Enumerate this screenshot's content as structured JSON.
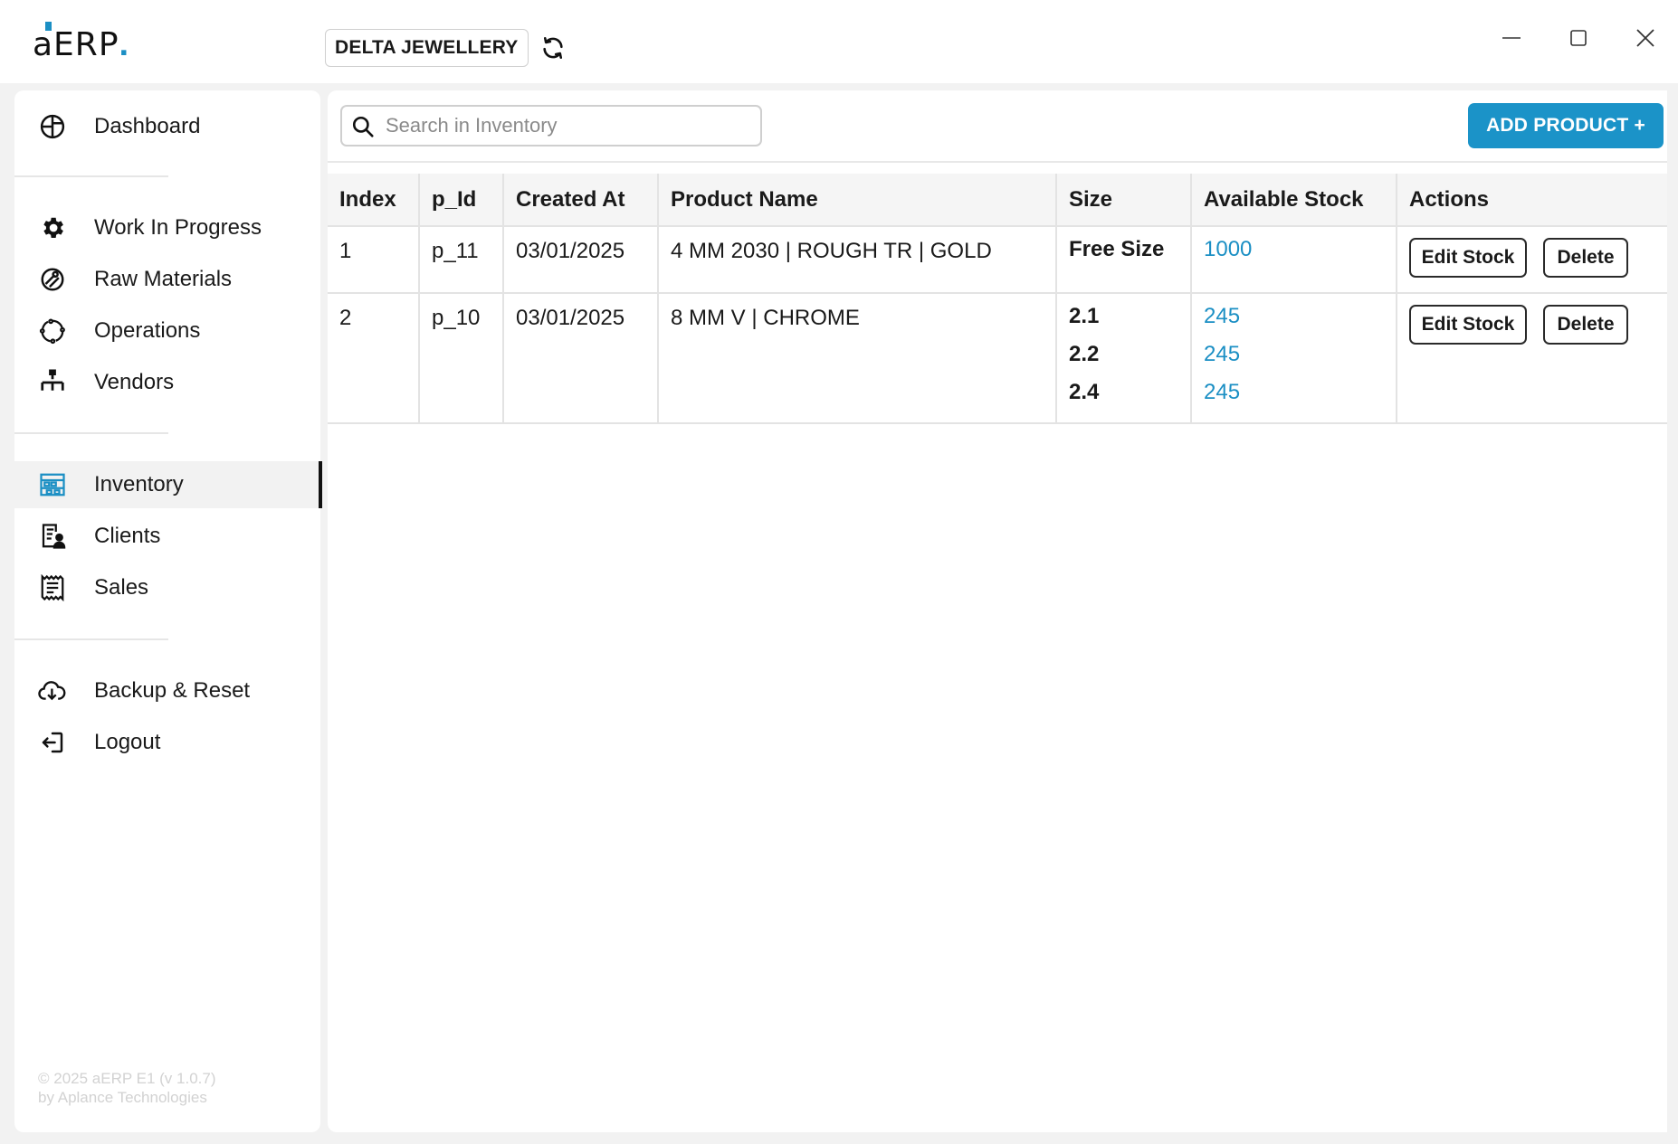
{
  "app": {
    "logo": "aERP",
    "logo_dot": ".",
    "company": "DELTA JEWELLERY",
    "window_controls": [
      "minimize-icon",
      "maximize-icon",
      "close-icon"
    ]
  },
  "colors": {
    "accent": "#1b93c8",
    "stock_link": "#1b8fc4",
    "active_nav_bg": "#f2f2f2"
  },
  "sidebar": {
    "items": [
      {
        "label": "Dashboard",
        "icon": "dashboard-icon"
      },
      {
        "label": "Work In Progress",
        "icon": "gear-icon"
      },
      {
        "label": "Raw Materials",
        "icon": "raw-materials-icon"
      },
      {
        "label": "Operations",
        "icon": "operations-icon"
      },
      {
        "label": "Vendors",
        "icon": "vendors-icon"
      },
      {
        "label": "Inventory",
        "icon": "inventory-icon",
        "active": true
      },
      {
        "label": "Clients",
        "icon": "clients-icon"
      },
      {
        "label": "Sales",
        "icon": "sales-icon"
      },
      {
        "label": "Backup & Reset",
        "icon": "cloud-icon"
      },
      {
        "label": "Logout",
        "icon": "logout-icon"
      }
    ],
    "copyright_line1": "© 2025 aERP E1 (v 1.0.7)",
    "copyright_line2": "by Aplance Technologies"
  },
  "main": {
    "search_placeholder": "Search in Inventory",
    "search_value": "",
    "add_product_label": "ADD PRODUCT +",
    "table": {
      "columns": [
        "Index",
        "p_Id",
        "Created At",
        "Product Name",
        "Size",
        "Available Stock",
        "Actions"
      ],
      "rows": [
        {
          "index": "1",
          "p_id": "p_11",
          "created_at": "03/01/2025",
          "product_name": "4 MM 2030 | ROUGH TR | GOLD",
          "sizes": [
            "Free Size"
          ],
          "stocks": [
            "1000"
          ]
        },
        {
          "index": "2",
          "p_id": "p_10",
          "created_at": "03/01/2025",
          "product_name": "8 MM V | CHROME",
          "sizes": [
            "2.1",
            "2.2",
            "2.4"
          ],
          "stocks": [
            "245",
            "245",
            "245"
          ]
        }
      ],
      "edit_label": "Edit Stock",
      "delete_label": "Delete"
    }
  }
}
